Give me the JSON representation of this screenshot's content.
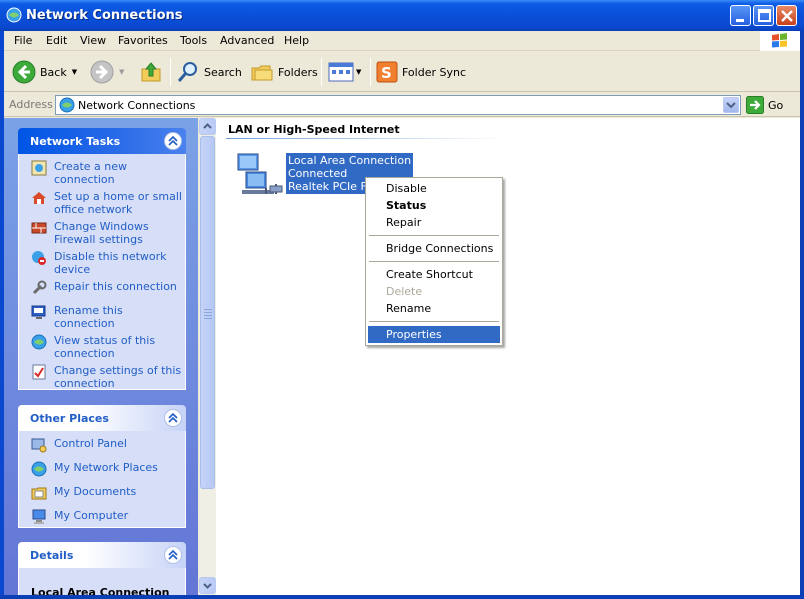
{
  "window": {
    "title": "Network Connections",
    "accent": "#0a4fd8"
  },
  "menubar": {
    "items": [
      "File",
      "Edit",
      "View",
      "Favorites",
      "Tools",
      "Advanced",
      "Help"
    ]
  },
  "toolbar": {
    "back_label": "Back",
    "search_label": "Search",
    "folders_label": "Folders",
    "foldersync_label": "Folder Sync"
  },
  "address": {
    "label": "Address",
    "value": "Network Connections",
    "go_label": "Go"
  },
  "left": {
    "network_tasks": {
      "title": "Network Tasks",
      "items": [
        {
          "line1": "Create a new",
          "line2": "connection",
          "icon": "new-connection-icon"
        },
        {
          "line1": "Set up a home or small",
          "line2": "office network",
          "icon": "home-network-icon"
        },
        {
          "line1": "Change Windows",
          "line2": "Firewall settings",
          "icon": "firewall-icon"
        },
        {
          "line1": "Disable this network",
          "line2": "device",
          "icon": "disable-network-icon"
        },
        {
          "line1": "Repair this connection",
          "line2": "",
          "icon": "repair-icon"
        },
        {
          "line1": "Rename this connection",
          "line2": "",
          "icon": "rename-icon"
        },
        {
          "line1": "View status of this",
          "line2": "connection",
          "icon": "status-icon"
        },
        {
          "line1": "Change settings of this",
          "line2": "connection",
          "icon": "settings-icon"
        }
      ]
    },
    "other_places": {
      "title": "Other Places",
      "items": [
        {
          "label": "Control Panel",
          "icon": "control-panel-icon"
        },
        {
          "label": "My Network Places",
          "icon": "network-places-icon"
        },
        {
          "label": "My Documents",
          "icon": "documents-icon"
        },
        {
          "label": "My Computer",
          "icon": "computer-icon"
        }
      ]
    },
    "details": {
      "title": "Details",
      "subtitle": "Local Area Connection"
    }
  },
  "main": {
    "group_title": "LAN or High-Speed Internet",
    "connection": {
      "name": "Local Area Connection",
      "status": "Connected",
      "device": "Realtek PCIe FE F"
    }
  },
  "context_menu": {
    "items": [
      {
        "label": "Disable",
        "style": "normal"
      },
      {
        "label": "Status",
        "style": "bold"
      },
      {
        "label": "Repair",
        "style": "normal"
      },
      {
        "label": "Bridge Connections",
        "style": "normal"
      },
      {
        "label": "Create Shortcut",
        "style": "normal"
      },
      {
        "label": "Delete",
        "style": "disabled"
      },
      {
        "label": "Rename",
        "style": "normal"
      },
      {
        "label": "Properties",
        "style": "selected"
      }
    ]
  }
}
